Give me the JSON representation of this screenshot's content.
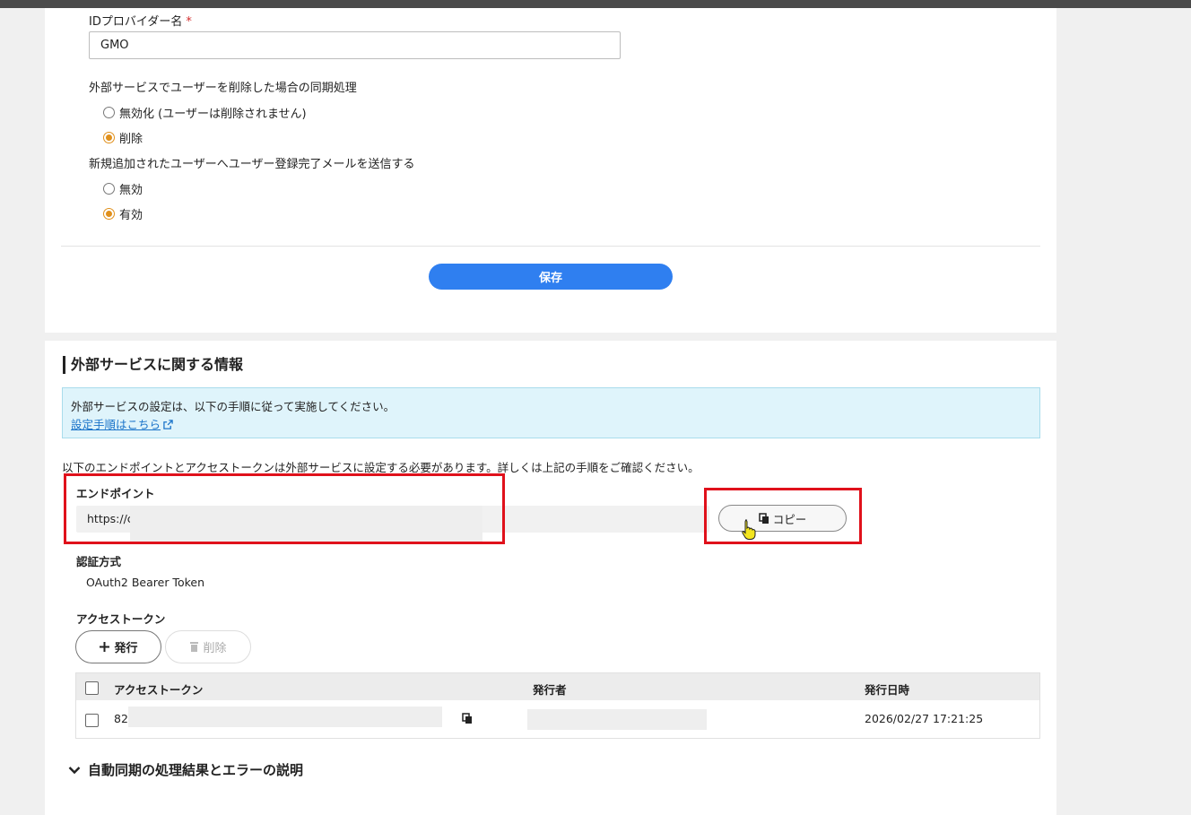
{
  "form": {
    "idp_label": "IDプロバイダー名",
    "required_mark": "*",
    "idp_value": "GMO",
    "sync_label": "外部サービスでユーザーを削除した場合の同期処理",
    "sync_options": [
      {
        "label": "無効化 (ユーザーは削除されません)",
        "checked": false
      },
      {
        "label": "削除",
        "checked": true
      }
    ],
    "mail_label": "新規追加されたユーザーへユーザー登録完了メールを送信する",
    "mail_options": [
      {
        "label": "無効",
        "checked": false
      },
      {
        "label": "有効",
        "checked": true
      }
    ],
    "save_label": "保存"
  },
  "external": {
    "title": "外部サービスに関する情報",
    "info_text": "外部サービスの設定は、以下の手順に従って実施してください。",
    "info_link": "設定手順はこちら",
    "note": "以下のエンドポイントとアクセストークンは外部サービスに設定する必要があります。詳しくは上記の手順をご確認ください。",
    "endpoint_label": "エンドポイント",
    "endpoint_value": "https://c",
    "copy_label": "コピー",
    "auth_label": "認証方式",
    "auth_value": "OAuth2 Bearer Token",
    "token_label": "アクセストークン",
    "issue_label": "発行",
    "delete_label": "削除",
    "table": {
      "headers": [
        "アクセストークン",
        "発行者",
        "発行日時"
      ],
      "rows": [
        {
          "token": "82",
          "issuer": "",
          "issued_at": "2026/02/27 17:21:25"
        }
      ]
    },
    "accordion_label": "自動同期の処理結果とエラーの説明"
  },
  "colors": {
    "accent": "#2f7ff0",
    "radio_checked": "#e0901c",
    "highlight": "#e0111b",
    "info_bg": "#dff4fb"
  }
}
